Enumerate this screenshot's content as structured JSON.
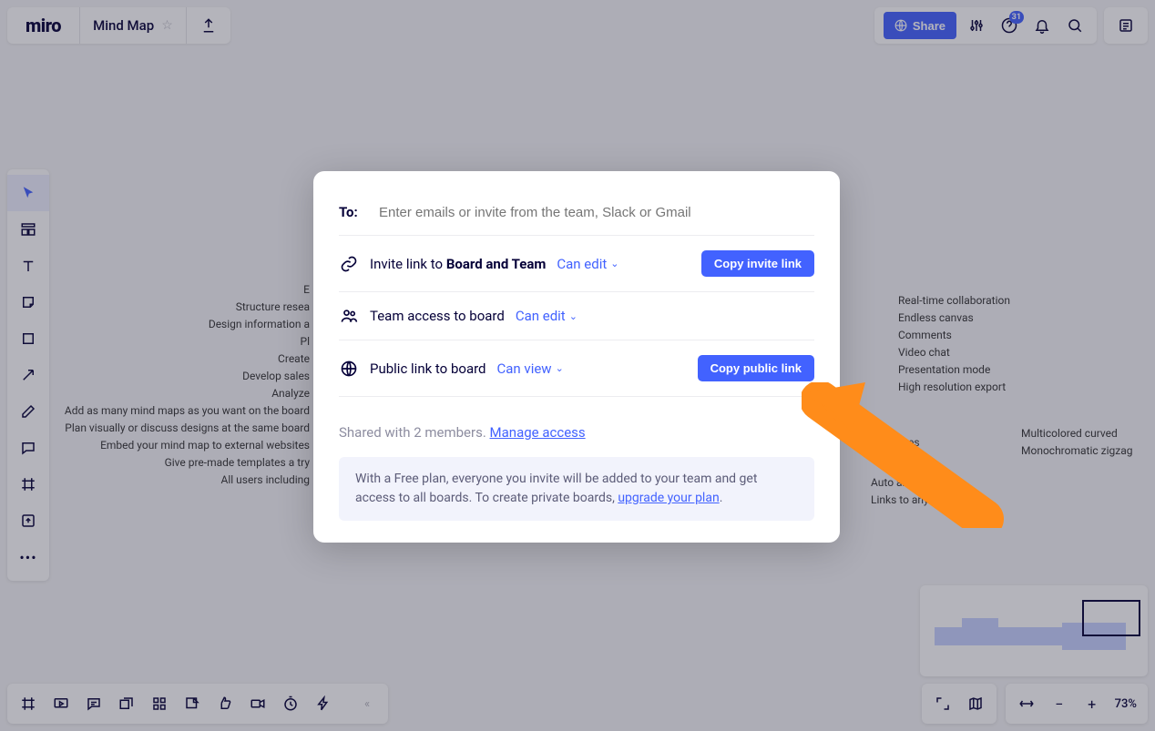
{
  "app": {
    "logo": "miro"
  },
  "board": {
    "name": "Mind Map"
  },
  "header": {
    "share_label": "Share",
    "notif_count": "31"
  },
  "zoom": {
    "level": "73%"
  },
  "modal": {
    "to_label": "To:",
    "to_placeholder": "Enter emails or invite from the team, Slack or Gmail",
    "invite_link_prefix": "Invite link to",
    "invite_link_target": "Board and Team",
    "invite_link_perm": "Can edit",
    "team_access_label": "Team access to board",
    "team_access_perm": "Can edit",
    "public_link_label": "Public link to board",
    "public_link_perm": "Can view",
    "copy_invite": "Copy invite link",
    "copy_public": "Copy public link",
    "shared_text": "Shared with 2 members.",
    "manage_access": "Manage access",
    "info_text": "With a Free plan, everyone you invite will be added to your team and get access to all boards. To create private boards, ",
    "upgrade": "upgrade your plan"
  },
  "mindLeft": [
    "E",
    "Structure resea",
    "Design information a",
    "Pl",
    "Create",
    "Develop sales",
    "Analyze",
    "Add as many mind maps as you want on the board",
    "Plan visually or discuss designs at the same board",
    "Embed your mind map to external websites",
    "Give pre-made templates a try",
    "All users including "
  ],
  "mindRight": [
    "Real-time collaboration",
    "Endless canvas",
    "Comments",
    "Video chat",
    "Presentation mode",
    "High resolution export"
  ],
  "mindRight2": [
    "Multicolored curved",
    "Monochromatic zigzag"
  ],
  "mindMid": [
    "nt themes",
    "Auto arrang",
    "Links to anything"
  ]
}
